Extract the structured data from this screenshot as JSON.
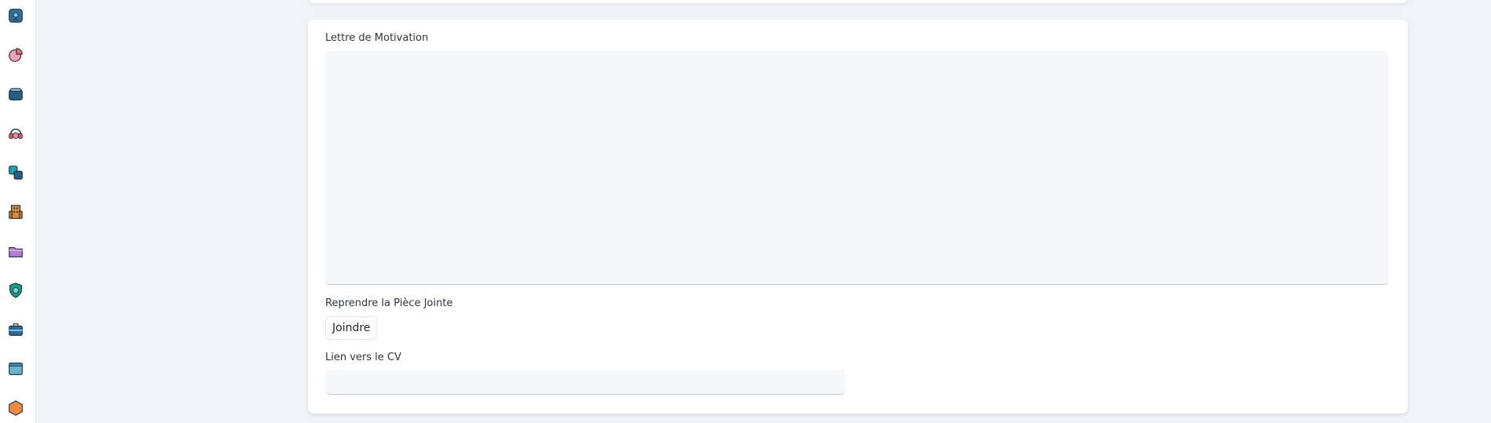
{
  "sidebar": {
    "items": [
      {
        "icon": "badge-icon",
        "color": "#2f6f99"
      },
      {
        "icon": "pie-chart-icon",
        "color": "#e86a7a"
      },
      {
        "icon": "wallet-icon",
        "color": "#2a5d86"
      },
      {
        "icon": "support-icon",
        "color": "#e1566b"
      },
      {
        "icon": "layers-icon",
        "color": "#1aa3b5"
      },
      {
        "icon": "building-icon",
        "color": "#d98c3a"
      },
      {
        "icon": "folder-icon",
        "color": "#b57ad1"
      },
      {
        "icon": "shield-icon",
        "color": "#13a08c"
      },
      {
        "icon": "briefcase-icon",
        "color": "#2a6a9a"
      },
      {
        "icon": "window-icon",
        "color": "#66b3cc"
      },
      {
        "icon": "hexagon-icon",
        "color": "#f08a3a"
      }
    ]
  },
  "form": {
    "motivation_label": "Lettre de Motivation",
    "motivation_value": "",
    "attachment_label": "Reprendre la Pièce Jointe",
    "attach_button": "Joindre",
    "cv_label": "Lien vers le CV",
    "cv_value": ""
  }
}
